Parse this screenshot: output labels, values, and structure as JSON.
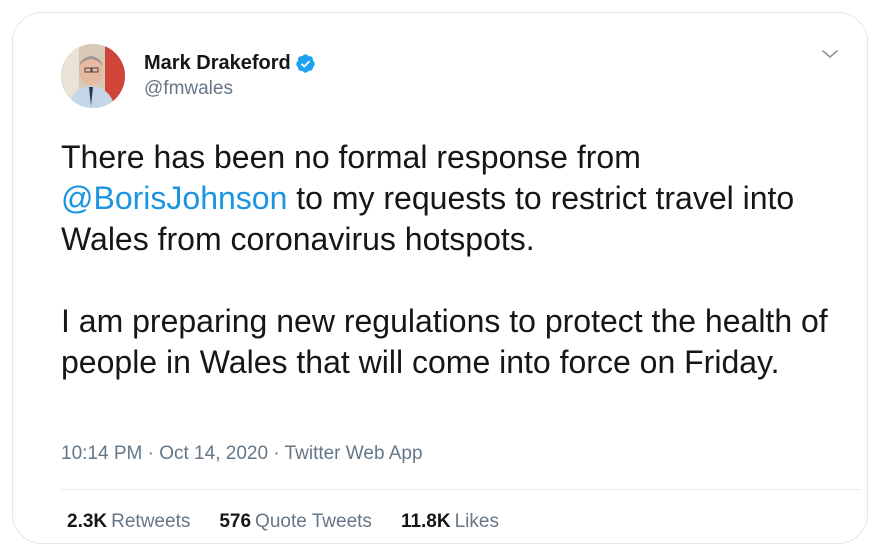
{
  "author": {
    "display_name": "Mark Drakeford",
    "handle": "@fmwales",
    "verified": true
  },
  "tweet": {
    "paragraph1_mention": "@BorisJohnson",
    "paragraph1_before": "There has been no formal response from ",
    "paragraph1_after": " to my requests to restrict travel into Wales from coronavirus hotspots.",
    "paragraph2": "I am preparing new regulations to protect the health of people in Wales that will come into force on Friday."
  },
  "meta": {
    "time": "10:14 PM",
    "separator1": " · ",
    "date": "Oct 14, 2020",
    "separator2": " · ",
    "source": "Twitter Web App"
  },
  "stats": {
    "retweets_count": "2.3K",
    "retweets_label": "Retweets",
    "quotes_count": "576",
    "quotes_label": "Quote Tweets",
    "likes_count": "11.8K",
    "likes_label": "Likes"
  },
  "colors": {
    "link": "#1b95e0",
    "verified": "#1da1f2",
    "secondary_text": "#657786"
  },
  "icons": {
    "verified": "verified-badge-icon",
    "more": "chevron-down-icon"
  }
}
